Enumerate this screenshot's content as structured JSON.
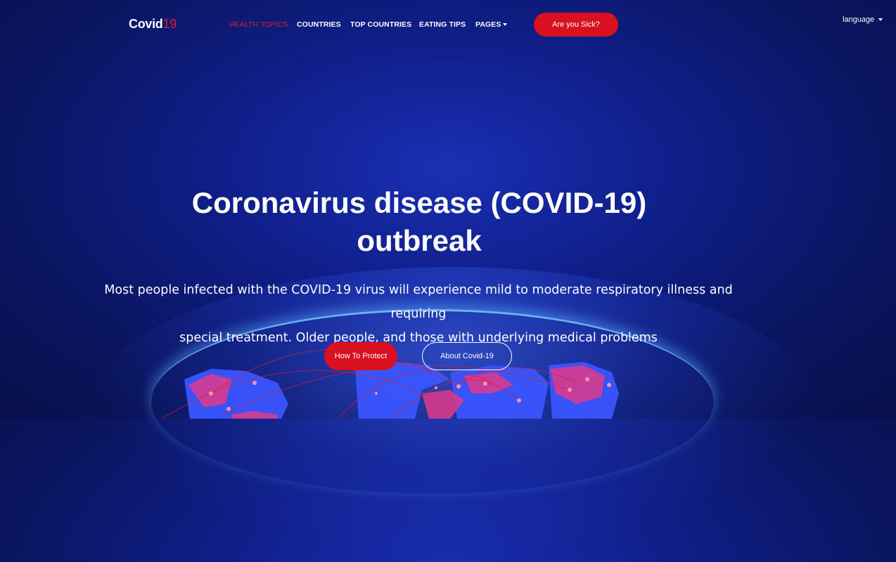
{
  "nav": {
    "logo_text": "Covid",
    "logo_num": "19",
    "items": [
      "HEALTH TOPICS",
      "COUNTRIES",
      "TOP COUNTRIES",
      "EATING TIPS",
      "PAGES"
    ],
    "cta": "Are you Sick?",
    "language": "language"
  },
  "hero": {
    "title_line1": "Coronavirus disease (COVID-19)",
    "title_line2": "outbreak",
    "lead_line1": "Most people infected with the COVID-19 virus will experience mild to moderate respiratory illness and requiring",
    "lead_line2": "special treatment. Older people, and those with underlying medical problems",
    "btn_primary": "How To Protect",
    "btn_secondary": "About Covid-19"
  },
  "colors": {
    "accent": "#d8101f",
    "background": "#0f1f8a",
    "text": "#ffffff"
  }
}
